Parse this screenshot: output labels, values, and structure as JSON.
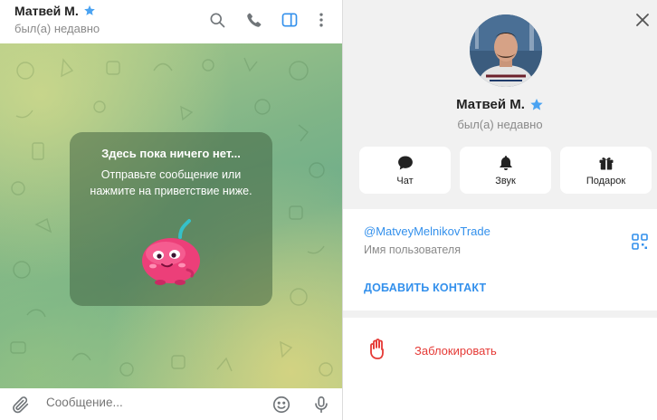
{
  "chat": {
    "peer_name": "Матвей М.",
    "peer_status": "был(а) недавно",
    "empty_title": "Здесь пока ничего нет...",
    "empty_text": "Отправьте сообщение или нажмите на приветствие ниже.",
    "composer_placeholder": "Сообщение...",
    "header_icons": [
      "search-icon",
      "phone-icon",
      "sidebar-toggle-icon",
      "more-vertical-icon"
    ],
    "composer_icons": [
      "paperclip-icon",
      "emoji-icon",
      "microphone-icon"
    ]
  },
  "profile": {
    "name": "Матвей М.",
    "status": "был(а) недавно",
    "actions": [
      {
        "icon": "chat-bubble-icon",
        "label": "Чат"
      },
      {
        "icon": "bell-icon",
        "label": "Звук"
      },
      {
        "icon": "gift-icon",
        "label": "Подарок"
      }
    ],
    "username": "@MatveyMelnikovTrade",
    "username_caption": "Имя пользователя",
    "add_contact": "ДОБАВИТЬ КОНТАКТ",
    "block_label": "Заблокировать"
  },
  "colors": {
    "accent": "#3390ec",
    "verified_star": "#4aa3f2",
    "danger": "#e53935",
    "chat_bg": "#7fb487"
  }
}
